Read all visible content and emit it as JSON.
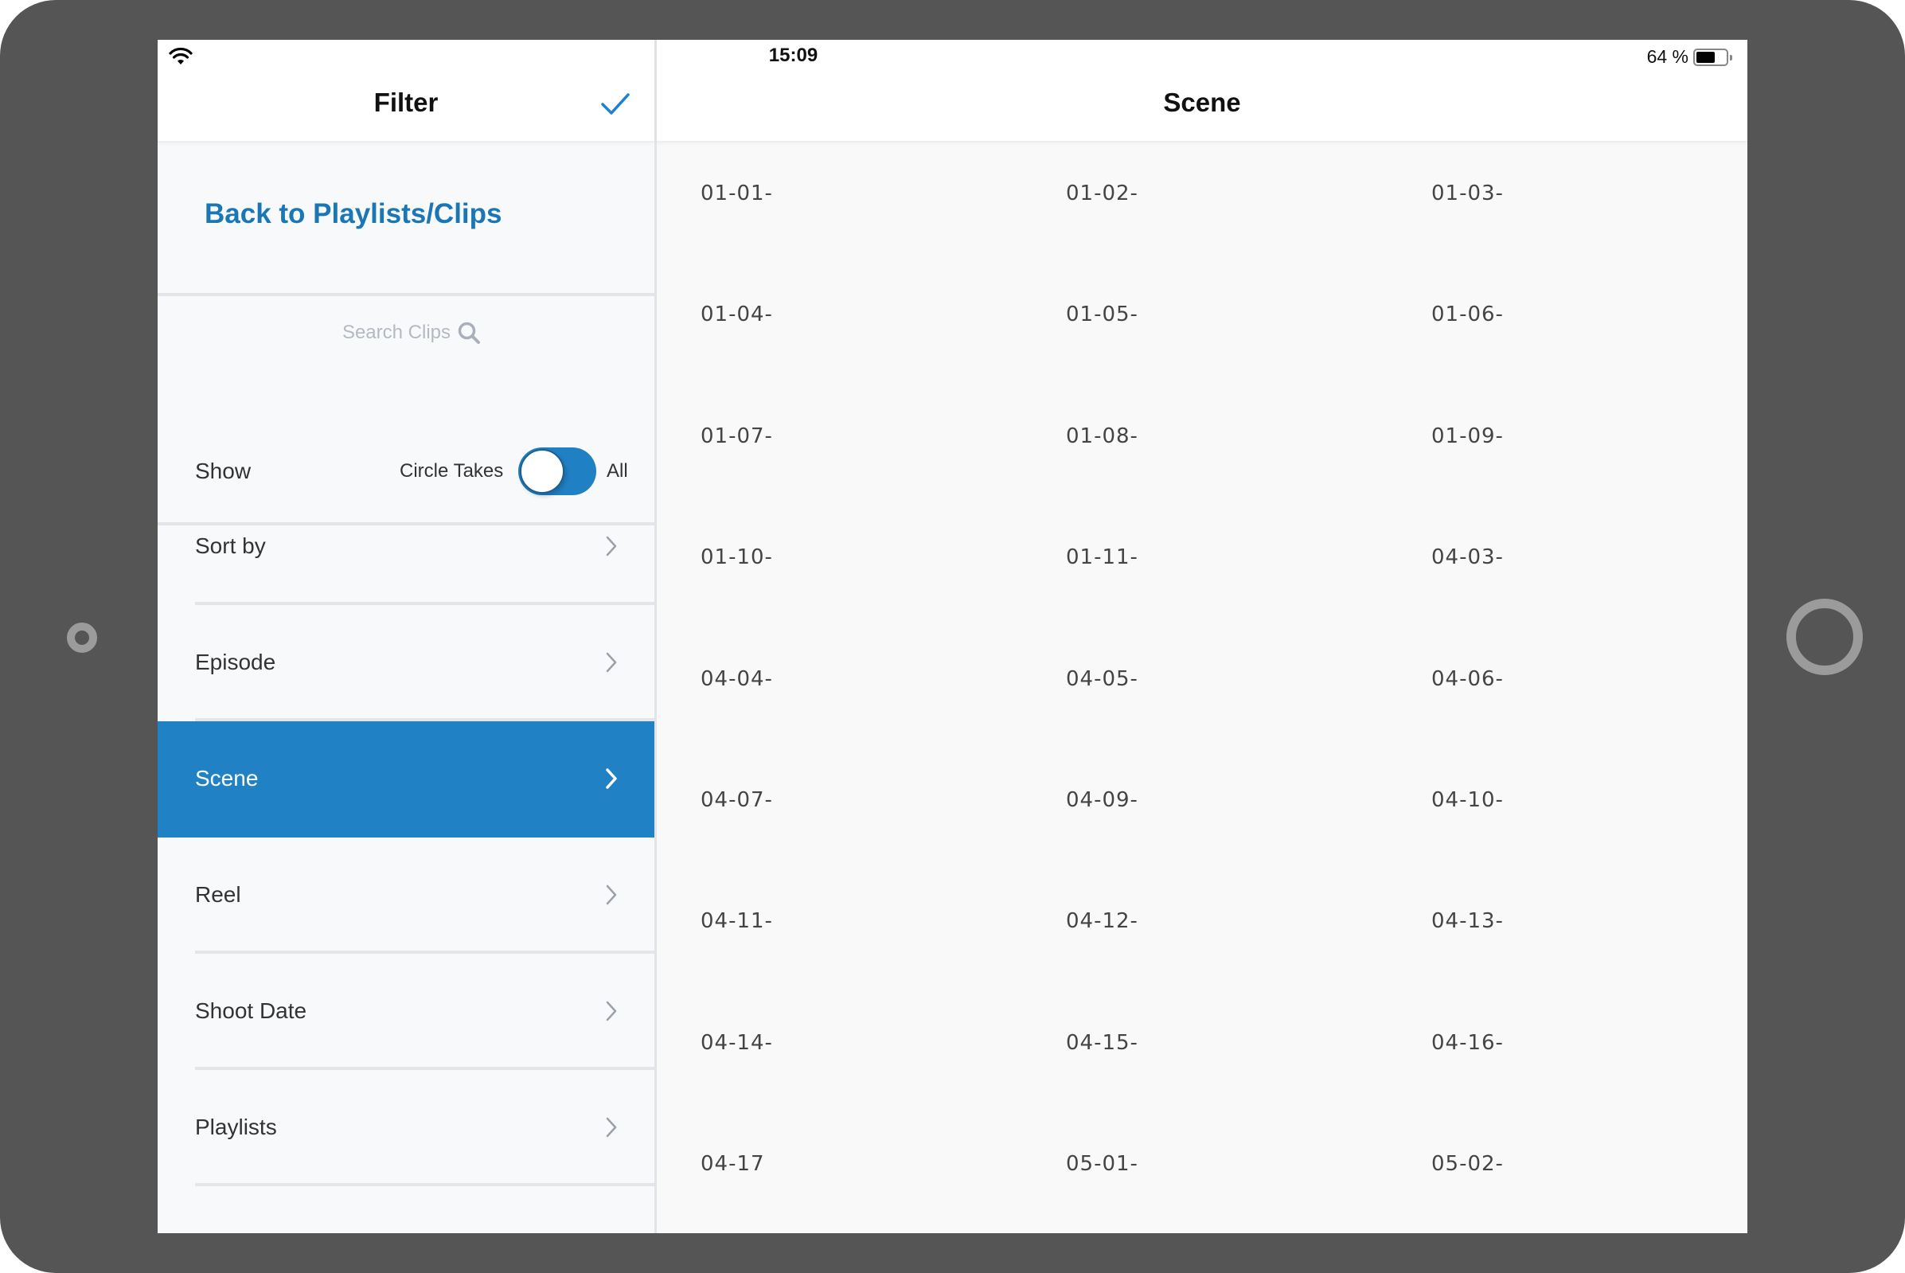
{
  "status_bar": {
    "time": "15:09",
    "battery_percent_label": "64 %",
    "battery_level": 0.64,
    "wifi_icon": "wifi-icon"
  },
  "filter_panel": {
    "title": "Filter",
    "done_icon": "checkmark-icon",
    "back_link": "Back to Playlists/Clips",
    "search": {
      "placeholder": "Search Clips",
      "value": "",
      "icon": "search-icon"
    },
    "show": {
      "label": "Show",
      "option_left": "Circle Takes",
      "option_right": "All",
      "toggle_state": "All"
    },
    "menu_items": [
      {
        "label": "Sort by",
        "selected": false
      },
      {
        "label": "Episode",
        "selected": false
      },
      {
        "label": "Scene",
        "selected": true
      },
      {
        "label": "Reel",
        "selected": false
      },
      {
        "label": "Shoot Date",
        "selected": false
      },
      {
        "label": "Playlists",
        "selected": false
      }
    ]
  },
  "scene_panel": {
    "title": "Scene",
    "scenes": [
      "01-01-",
      "01-02-",
      "01-03-",
      "01-04-",
      "01-05-",
      "01-06-",
      "01-07-",
      "01-08-",
      "01-09-",
      "01-10-",
      "01-11-",
      "04-03-",
      "04-04-",
      "04-05-",
      "04-06-",
      "04-07-",
      "04-09-",
      "04-10-",
      "04-11-",
      "04-12-",
      "04-13-",
      "04-14-",
      "04-15-",
      "04-16-",
      "04-17",
      "05-01-",
      "05-02-"
    ]
  },
  "colors": {
    "accent": "#2081c5",
    "link": "#1b76b6",
    "bezel": "#555555"
  }
}
